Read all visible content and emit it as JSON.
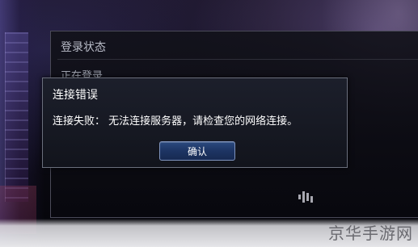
{
  "login_panel": {
    "title": "登录状态",
    "status": "正在登录……"
  },
  "dialog": {
    "title": "连接错误",
    "message": "连接失败： 无法连接服务器，请检查您的网络连接。",
    "ok_label": "确认"
  },
  "watermark": "京华手游网",
  "colors": {
    "button_bg": "#1d3463",
    "dialog_bg": "#1c1f2b",
    "dialog_border": "#6b6f7d"
  }
}
